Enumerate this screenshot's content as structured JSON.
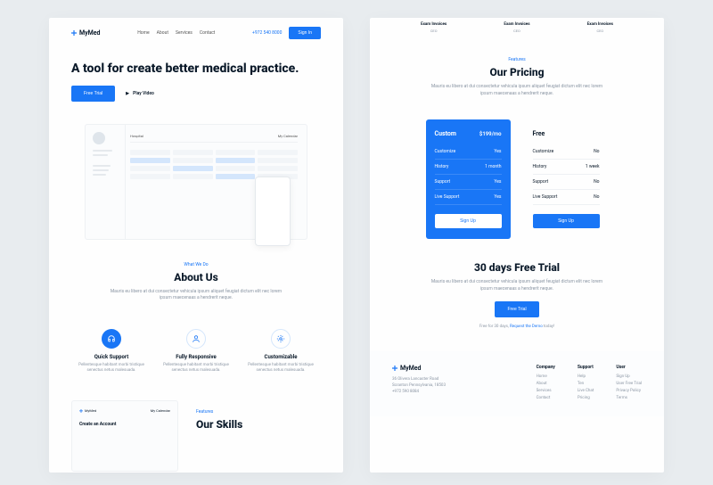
{
  "brand": "MyMed",
  "nav": {
    "links": [
      "Home",
      "About",
      "Services",
      "Contact"
    ],
    "phone": "+972 540 8000",
    "signin": "Sign In"
  },
  "hero": {
    "title": "A tool for create better medical practice.",
    "cta": "Free Trial",
    "video": "Play Video"
  },
  "about": {
    "eyebrow": "What We Do",
    "title": "About Us",
    "desc": "Mauris eu libero at dui consectetur vehicula ipsum aliquet feugiat dictum elit nec lorem ipsum maecenaas a hendrerit neque."
  },
  "features": [
    {
      "title": "Quick Support",
      "desc": "Pellentesque habitant morbi tristique senectus netus malesuada."
    },
    {
      "title": "Fully Responsive",
      "desc": "Pellentesque habitant morbi tristique senectus netus malesuada."
    },
    {
      "title": "Customizable",
      "desc": "Pellentesque habitant morbi tristique senectus netus malesuada."
    }
  ],
  "skills": {
    "eyebrow": "Features",
    "title": "Our Skills",
    "create": "Create an Account",
    "calendar": "My Calendar"
  },
  "topboxes": [
    {
      "title": "Exam Invoices",
      "sub": "CEO"
    },
    {
      "title": "Exam Invoices",
      "sub": "CEO"
    },
    {
      "title": "Exam Invoices",
      "sub": "CEO"
    }
  ],
  "pricing": {
    "eyebrow": "Features",
    "title": "Our Pricing",
    "desc": "Mauris eu libero at dui consectetur vehicula ipsum aliquet feugiat dictum elit nec lorem ipsum maecenaas a hendrerit neque.",
    "custom": {
      "name": "Custom",
      "price": "$199/mo",
      "rows": [
        [
          "Customize",
          "Yes"
        ],
        [
          "History",
          "1 month"
        ],
        [
          "Support",
          "Yes"
        ],
        [
          "Live Support",
          "Yes"
        ]
      ],
      "btn": "Sign Up"
    },
    "free": {
      "name": "Free",
      "rows": [
        [
          "Customize",
          "No"
        ],
        [
          "History",
          "1 week"
        ],
        [
          "Support",
          "No"
        ],
        [
          "Live Support",
          "No"
        ]
      ],
      "btn": "Sign Up"
    }
  },
  "trial": {
    "title": "30 days Free Trial",
    "desc": "Mauris eu libero at dui consectetur vehicula ipsum aliquet feugiat dictum elit nec lorem ipsum maecenaas a hendrerit neque.",
    "btn": "Free Trial",
    "note": "Free for 30 days, ",
    "link": "Request the Demo",
    "note2": " today!"
  },
  "footer": {
    "address": "36 Olivera Lancaster Road\nScranton Pennsylvania, 18503\n+972 590 8084",
    "cols": [
      {
        "title": "Company",
        "links": [
          "Home",
          "About",
          "Services",
          "Contact"
        ]
      },
      {
        "title": "Support",
        "links": [
          "Help",
          "Ten",
          "Live Chat",
          "Pricing"
        ]
      },
      {
        "title": "User",
        "links": [
          "Sign Up",
          "User Free Trial",
          "Privacy Policy",
          "Terms"
        ]
      }
    ]
  }
}
